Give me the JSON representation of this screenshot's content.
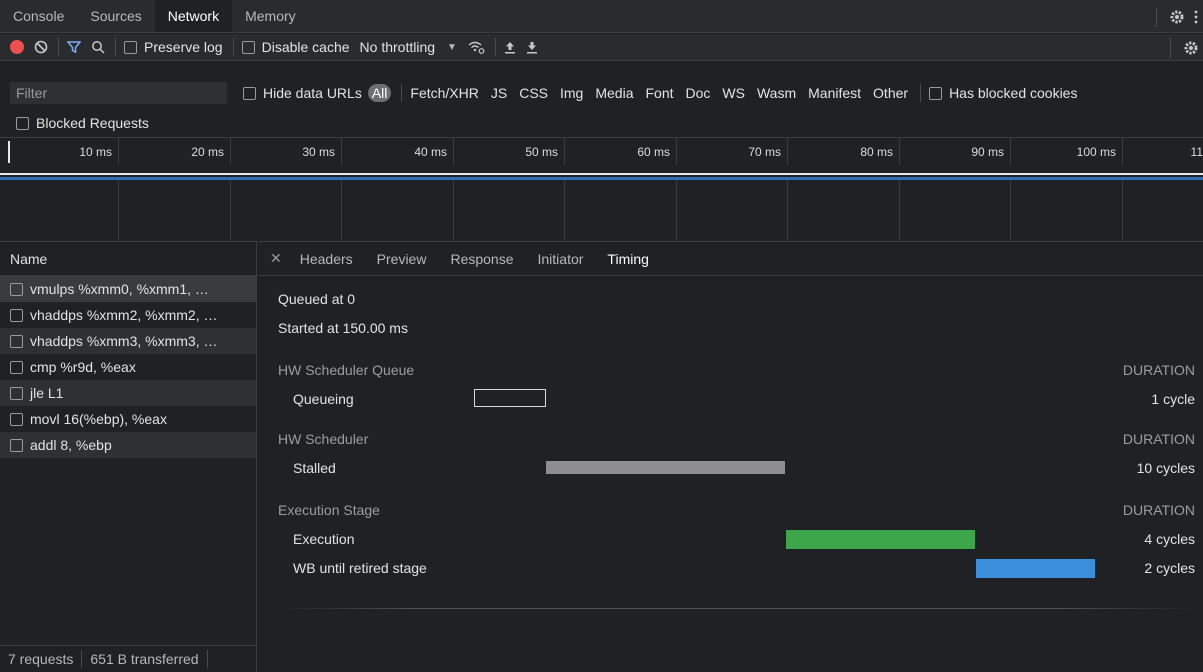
{
  "tabs": [
    {
      "label": "Console"
    },
    {
      "label": "Sources"
    },
    {
      "label": "Network"
    },
    {
      "label": "Memory"
    }
  ],
  "toolbar": {
    "preserve_log": "Preserve log",
    "disable_cache": "Disable cache",
    "throttling": "No throttling"
  },
  "filter": {
    "placeholder": "Filter",
    "hide_data_urls": "Hide data URLs",
    "all": "All",
    "types": [
      "Fetch/XHR",
      "JS",
      "CSS",
      "Img",
      "Media",
      "Font",
      "Doc",
      "WS",
      "Wasm",
      "Manifest",
      "Other"
    ],
    "has_blocked_cookies": "Has blocked cookies",
    "blocked_requests": "Blocked Requests"
  },
  "ruler": {
    "ticks": [
      "10 ms",
      "20 ms",
      "30 ms",
      "40 ms",
      "50 ms",
      "60 ms",
      "70 ms",
      "80 ms",
      "90 ms",
      "100 ms",
      "11"
    ]
  },
  "requests": {
    "header": "Name",
    "items": [
      "vmulps %xmm0, %xmm1, …",
      "vhaddps %xmm2, %xmm2, …",
      "vhaddps %xmm3, %xmm3, …",
      "cmp %r9d, %eax",
      "jle L1",
      "movl 16(%ebp), %eax",
      "addl 8, %ebp"
    ],
    "status_requests": "7 requests",
    "status_transferred": "651 B transferred"
  },
  "detail_tabs": [
    "Headers",
    "Preview",
    "Response",
    "Initiator",
    "Timing"
  ],
  "timing": {
    "queued_at": "Queued at 0",
    "started_at": "Started at 150.00 ms",
    "duration_label": "DURATION",
    "sections": [
      {
        "title": "HW Scheduler Queue",
        "phases": [
          {
            "label": "Queueing",
            "value": "1 cycle"
          }
        ]
      },
      {
        "title": "HW Scheduler",
        "phases": [
          {
            "label": "Stalled",
            "value": "10 cycles"
          }
        ]
      },
      {
        "title": "Execution Stage",
        "phases": [
          {
            "label": "Execution",
            "value": "4 cycles"
          },
          {
            "label": "WB until retired stage",
            "value": "2 cycles"
          }
        ]
      }
    ]
  },
  "colors": {
    "stalled": "#8e8e90",
    "execution": "#3ea64a",
    "wb": "#3b8fdb",
    "record": "#ee4f4f",
    "accent_blue": "#2e6fb6"
  }
}
